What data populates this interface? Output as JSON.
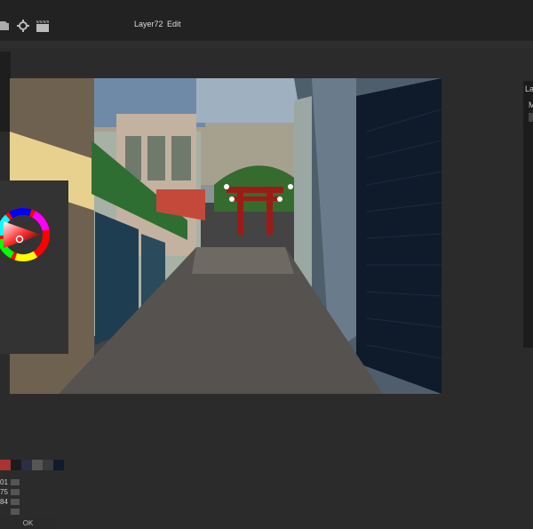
{
  "header": {
    "layer_name": "Layer72",
    "edit_menu": "Edit"
  },
  "right_panel": {
    "title": "La",
    "sublabel": "M"
  },
  "color_picker": {
    "swatches": [
      "#a33",
      "#1c1c1c",
      "#2a2f45",
      "#555",
      "#3a3a3a",
      "#0f1b2a",
      "#444"
    ],
    "fields": [
      "01",
      "75",
      "84",
      ""
    ],
    "ok_label": "OK"
  },
  "colors": {
    "accent_red": "#9b1c16",
    "panel_bg": "#2b2b2b"
  }
}
